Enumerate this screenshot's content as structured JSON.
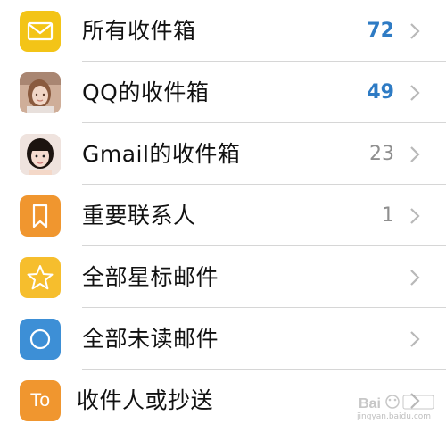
{
  "mailboxes": [
    {
      "label": "所有收件箱",
      "count": "72",
      "icon": "envelope-icon",
      "icon_bg": "#f3c417",
      "count_color": "#2e7bc4",
      "bold": true
    },
    {
      "label": "QQ的收件箱",
      "count": "49",
      "icon": "avatar-photo-1",
      "icon_bg": "#c89a7e",
      "count_color": "#2e7bc4",
      "bold": true
    },
    {
      "label": "Gmail的收件箱",
      "count": "23",
      "icon": "avatar-photo-2",
      "icon_bg": "#eadad2",
      "count_color": "#8f8f8f",
      "bold": false
    },
    {
      "label": "重要联系人",
      "count": "1",
      "icon": "bookmark-icon",
      "icon_bg": "#f0962f",
      "count_color": "#8f8f8f",
      "bold": false
    },
    {
      "label": "全部星标邮件",
      "count": "",
      "icon": "star-icon",
      "icon_bg": "#f6be2d",
      "count_color": "#8f8f8f",
      "bold": false
    },
    {
      "label": "全部未读邮件",
      "count": "",
      "icon": "circle-icon",
      "icon_bg": "#3d8fd6",
      "count_color": "#8f8f8f",
      "bold": false
    },
    {
      "label": "收件人或抄送",
      "count": "",
      "icon": "to-icon",
      "icon_bg": "#f0962f",
      "count_color": "#8f8f8f",
      "bold": false
    }
  ],
  "icon_text": {
    "to": "To"
  },
  "watermark": {
    "text": "jingyan.baidu.com"
  }
}
